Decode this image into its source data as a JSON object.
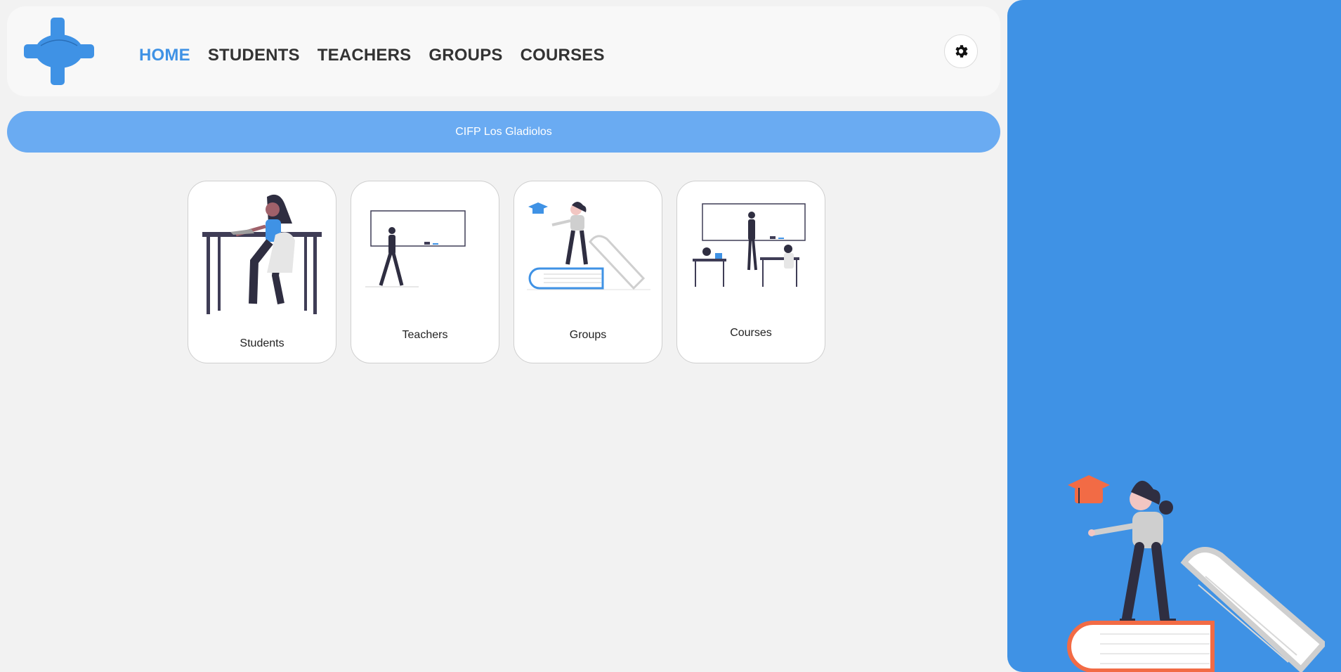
{
  "nav": {
    "items": [
      {
        "label": "HOME",
        "active": true
      },
      {
        "label": "STUDENTS",
        "active": false
      },
      {
        "label": "TEACHERS",
        "active": false
      },
      {
        "label": "GROUPS",
        "active": false
      },
      {
        "label": "COURSES",
        "active": false
      }
    ],
    "settings_icon": "gear-icon",
    "logo_icon": "cross-logo-icon"
  },
  "banner": {
    "text": "CIFP Los Gladiolos"
  },
  "cards": [
    {
      "label": "Students",
      "icon": "student-at-desk-illustration"
    },
    {
      "label": "Teachers",
      "icon": "teacher-at-whiteboard-illustration"
    },
    {
      "label": "Groups",
      "icon": "graduate-on-books-illustration"
    },
    {
      "label": "Courses",
      "icon": "classroom-illustration"
    }
  ],
  "colors": {
    "accent": "#3f92e5",
    "banner": "#6aabf2",
    "page_bg": "#f2f2f2",
    "header_bg": "#f8f8f8",
    "nav_text": "#333333",
    "hero_cap": "#f26b45"
  }
}
